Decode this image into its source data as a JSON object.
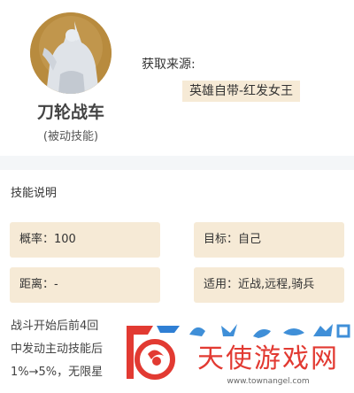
{
  "skill": {
    "name": "刀轮战车",
    "type": "(被动技能)",
    "source_label": "获取来源:",
    "source_value": "英雄自带-红发女王"
  },
  "section_title": "技能说明",
  "stats": {
    "probability": "概率：100",
    "target": "目标：自己",
    "distance": "距离：-",
    "applicable": "适用：近战,远程,骑兵"
  },
  "description": [
    "战斗开始后前4回",
    "中发动主动技能后",
    "1%→5%，无限星"
  ],
  "watermark": {
    "text": "天使游戏网",
    "url": "www.townangel.com"
  },
  "colors": {
    "accent": "#f6ead6",
    "brand_red": "#e23a32",
    "divider": "#f4f6f8"
  }
}
